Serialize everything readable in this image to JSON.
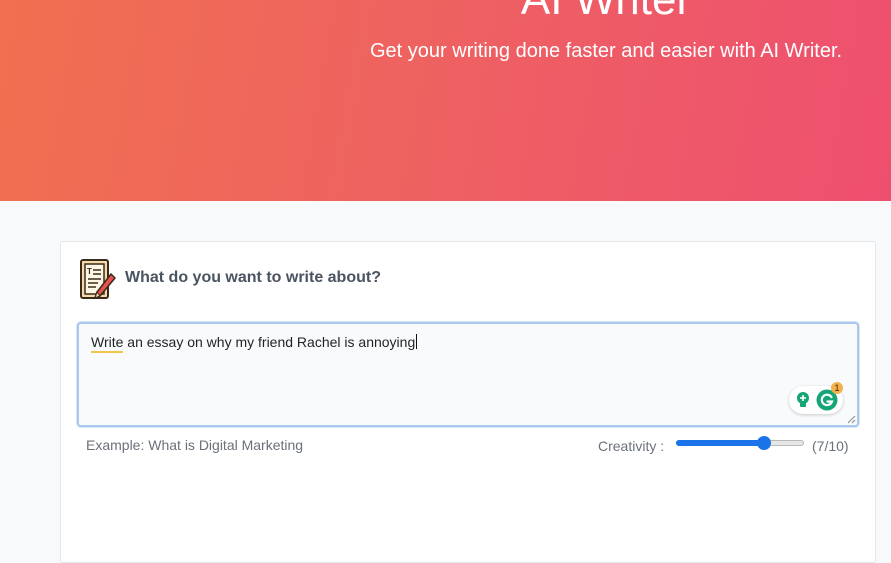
{
  "header": {
    "title": "AI Writer",
    "subtitle": "Get your writing done faster and easier with AI Writer."
  },
  "prompt": {
    "label": "What do you want to write about?",
    "icon": "notepad-pencil-icon",
    "topic_value": "Write an essay on why my friend Rachel is annoying",
    "example": "Example: What is Digital Marketing"
  },
  "extensions": {
    "grammarly_badge": "1"
  },
  "creativity": {
    "label": "Creativity :",
    "value": 7,
    "max": 10,
    "value_text": "(7/10)"
  },
  "colors": {
    "gradient_start": "#f07050",
    "gradient_end": "#ee4f6f",
    "accent_blue": "#1a73e8",
    "grammarly_green": "#15a577"
  }
}
